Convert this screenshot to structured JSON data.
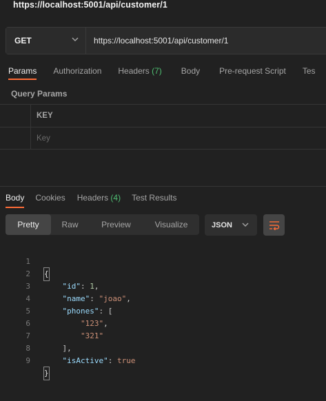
{
  "request": {
    "title": "https://localhost:5001/api/customer/1",
    "method": "GET",
    "url": "https://localhost:5001/api/customer/1"
  },
  "request_tabs": [
    {
      "label": "Params",
      "count": ""
    },
    {
      "label": "Authorization",
      "count": ""
    },
    {
      "label": "Headers",
      "count": "(7)"
    },
    {
      "label": "Body",
      "count": ""
    },
    {
      "label": "Pre-request Script",
      "count": ""
    },
    {
      "label": "Tes",
      "count": ""
    }
  ],
  "query_params": {
    "title": "Query Params",
    "key_header": "KEY",
    "key_placeholder": "Key"
  },
  "response_tabs": [
    {
      "label": "Body",
      "count": ""
    },
    {
      "label": "Cookies",
      "count": ""
    },
    {
      "label": "Headers",
      "count": "(4)"
    },
    {
      "label": "Test Results",
      "count": ""
    }
  ],
  "view_modes": [
    "Pretty",
    "Raw",
    "Preview",
    "Visualize"
  ],
  "format": "JSON",
  "code_lines": [
    {
      "n": "1"
    },
    {
      "n": "2"
    },
    {
      "n": "3"
    },
    {
      "n": "4"
    },
    {
      "n": "5"
    },
    {
      "n": "6"
    },
    {
      "n": "7"
    },
    {
      "n": "8"
    },
    {
      "n": "9"
    }
  ],
  "json_body": {
    "open": "{",
    "close": "}",
    "k_id": "\"id\"",
    "v_id": "1",
    "k_name": "\"name\"",
    "v_name": "\"joao\"",
    "k_phones": "\"phones\"",
    "p1": "\"123\"",
    "p2": "\"321\"",
    "k_active": "\"isActive\"",
    "v_active": "true"
  },
  "colors": {
    "accent": "#ff6c37",
    "count_green": "#4fbf73",
    "json_key": "#9cdcfe",
    "json_string": "#ce9178",
    "json_number": "#b5cea8"
  }
}
